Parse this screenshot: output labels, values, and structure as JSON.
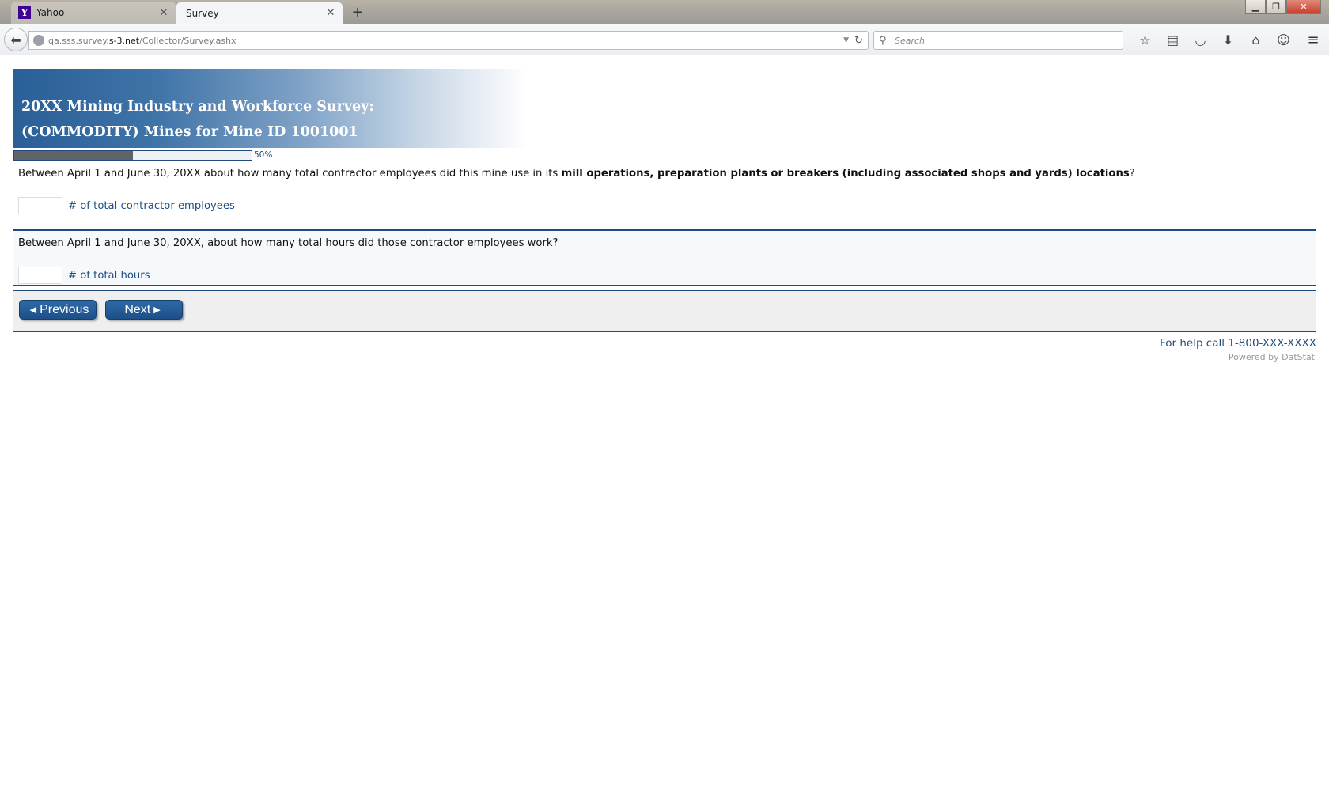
{
  "browser": {
    "tabs": [
      {
        "label": "Yahoo",
        "favicon": "Y"
      },
      {
        "label": "Survey"
      }
    ],
    "url": {
      "host_prefix": "qa.sss.survey.",
      "domain": "s-3.net",
      "path": "/Collector/Survey.ashx"
    },
    "search_placeholder": "Search"
  },
  "survey": {
    "title_line1": "20XX Mining Industry and Workforce Survey:",
    "title_line2": "(COMMODITY) Mines for Mine ID 1001001",
    "progress": {
      "value": 50,
      "label": "50%"
    },
    "q1": {
      "text_before": "Between April 1 and June 30, 20XX about how many total contractor employees did this mine use in its ",
      "text_bold": "mill operations, preparation plants or breakers (including associated shops and yards) locations",
      "text_after": "?",
      "value": "",
      "unit_label": "# of total contractor employees"
    },
    "q2": {
      "text": "Between April 1 and June 30, 20XX, about how many total hours did those contractor employees work?",
      "value": "",
      "unit_label": "# of total hours"
    },
    "buttons": {
      "previous": "Previous",
      "next": "Next"
    },
    "help": "For help call 1-800-XXX-XXXX",
    "powered_by": "Powered by DatStat"
  },
  "colors": {
    "accent": "#1f4e80",
    "button": "#2a5f97",
    "progress_fill": "#5f6468"
  }
}
